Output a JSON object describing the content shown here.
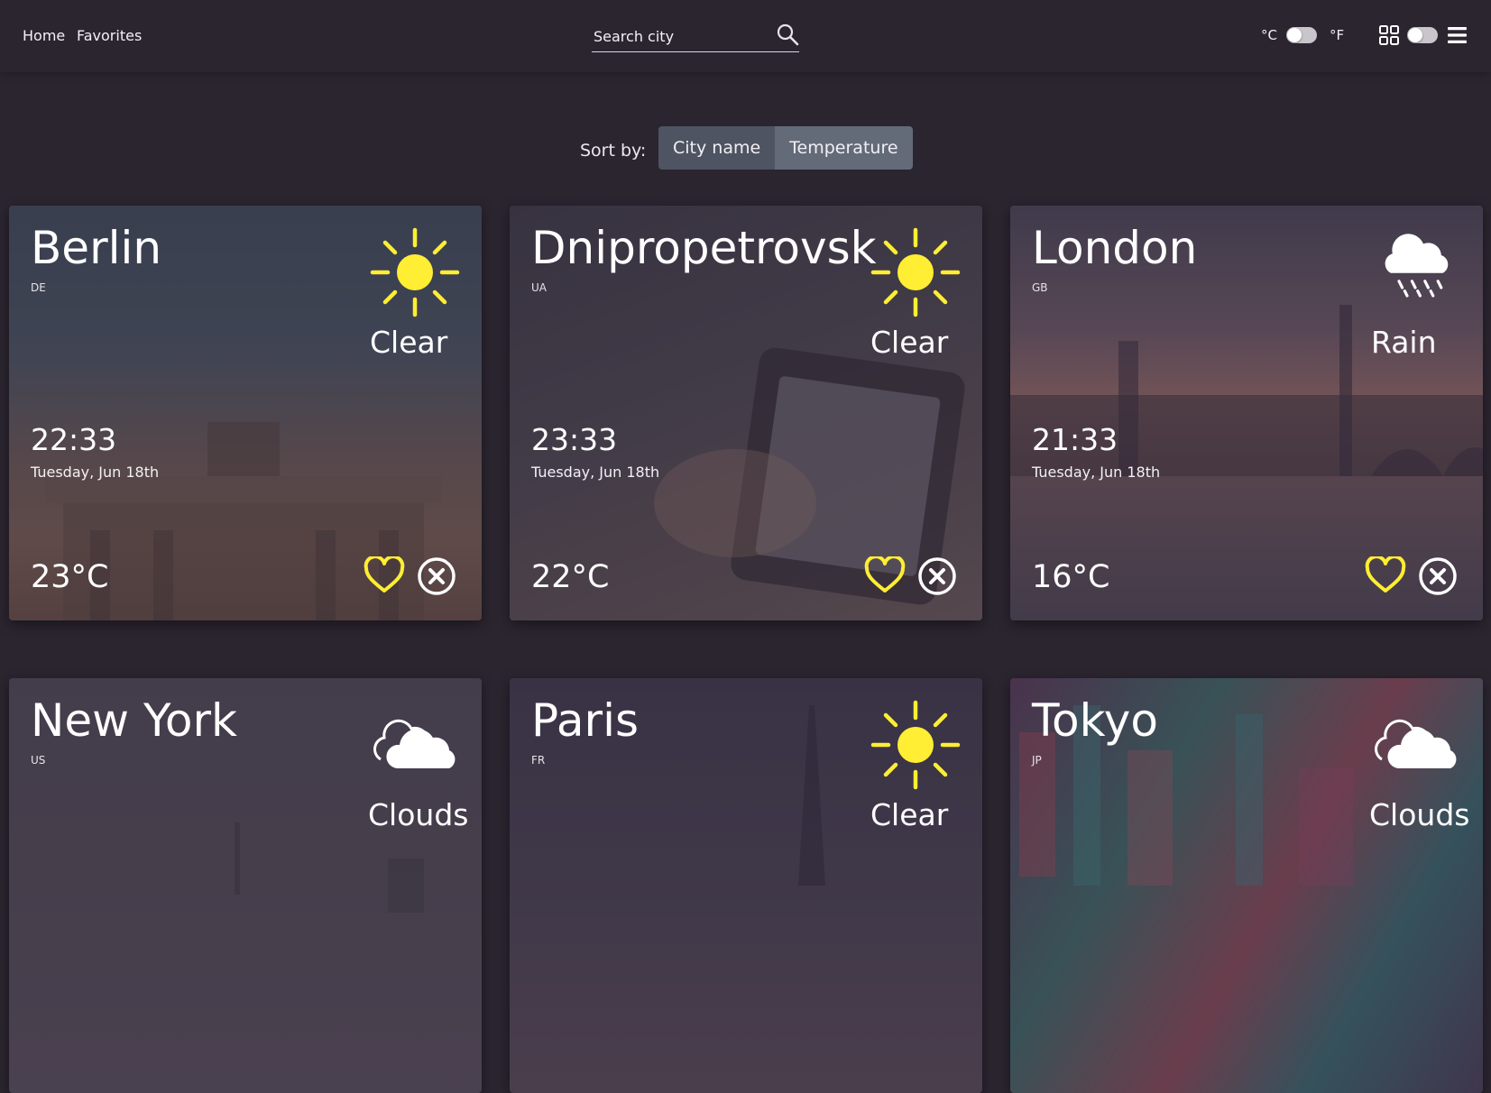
{
  "header": {
    "nav": [
      {
        "label": "Home"
      },
      {
        "label": "Favorites"
      }
    ],
    "search": {
      "placeholder": "Search city",
      "icon": "search-icon"
    },
    "units": {
      "celsius": "°C",
      "fahrenheit": "°F",
      "selected": "°C"
    },
    "icons": {
      "layout": "grid-icon",
      "menu": "menu-icon"
    }
  },
  "sort": {
    "label": "Sort by:",
    "options": [
      {
        "label": "City name"
      },
      {
        "label": "Temperature"
      }
    ]
  },
  "colors": {
    "background": "#2b2530",
    "accent_yellow": "#ffee33",
    "text": "#ffffff"
  },
  "cards": [
    {
      "city": "Berlin",
      "country": "DE",
      "condition": "Clear",
      "icon": "sun-icon",
      "time": "22:33",
      "date": "Tuesday, Jun 18th",
      "temp": "23°C"
    },
    {
      "city": "Dnipropetrovsk",
      "country": "UA",
      "condition": "Clear",
      "icon": "sun-icon",
      "time": "23:33",
      "date": "Tuesday, Jun 18th",
      "temp": "22°C"
    },
    {
      "city": "London",
      "country": "GB",
      "condition": "Rain",
      "icon": "rain-cloud-icon",
      "time": "21:33",
      "date": "Tuesday, Jun 18th",
      "temp": "16°C"
    },
    {
      "city": "New York",
      "country": "US",
      "condition": "Clouds",
      "icon": "clouds-icon"
    },
    {
      "city": "Paris",
      "country": "FR",
      "condition": "Clear",
      "icon": "sun-icon"
    },
    {
      "city": "Tokyo",
      "country": "JP",
      "condition": "Clouds",
      "icon": "clouds-icon"
    }
  ]
}
